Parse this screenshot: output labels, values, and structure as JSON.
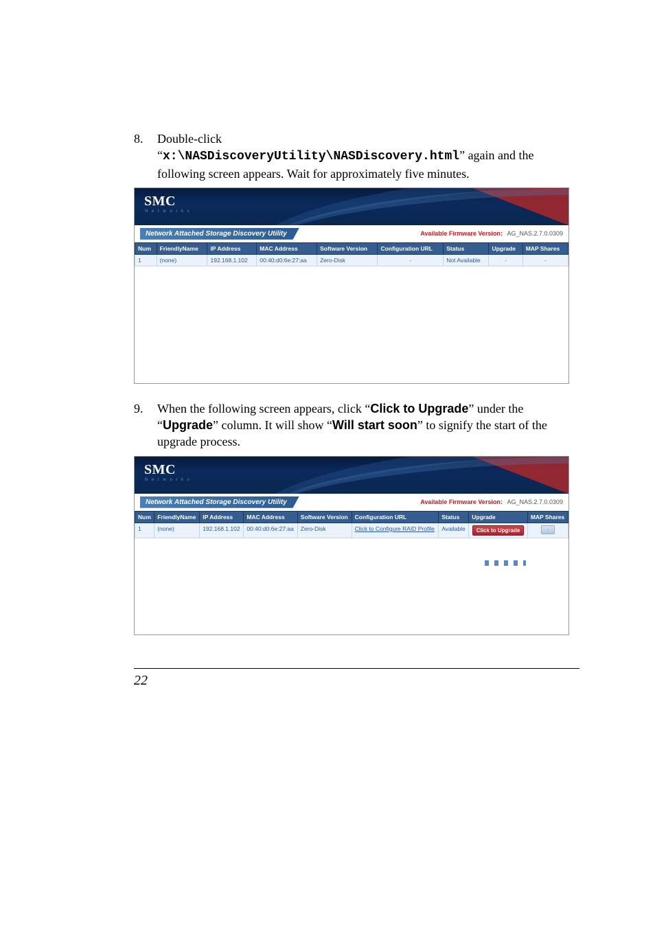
{
  "step8": {
    "num": "8.",
    "title": "Double-click",
    "path_pre": "“",
    "path": "x:\\NASDiscoveryUtility\\NASDiscovery.html",
    "path_post": "” again and the following screen appears. Wait for approximately five minutes."
  },
  "step9": {
    "num": "9.",
    "line1_a": "When the following screen appears, click “",
    "bold1": "Click to Upgrade",
    "line1_b": "” under the “",
    "bold2": "Upgrade",
    "line2_a": "” column. It will show “",
    "bold3": "Will start soon",
    "line2_b": "” to signify the start of the upgrade process."
  },
  "logo": {
    "main": "SMC",
    "sub": "N e t w o r k s"
  },
  "utility_title": "Network Attached Storage Discovery Utility",
  "fw_label": "Available Firmware Version:",
  "fw_value": "AG_NAS.2.7.0.0309",
  "headers1": [
    "Num",
    "FriendlyName",
    "IP Address",
    "MAC Address",
    "Software Version",
    "Configuration URL",
    "Status",
    "Upgrade",
    "MAP Shares"
  ],
  "row1": {
    "num": "1",
    "name": "(none)",
    "ip": "192.168.1.102",
    "mac": "00:40:d0:6e:27:aa",
    "sw": "Zero-Disk",
    "cfg": "-",
    "status": "Not Available",
    "upgrade": "-",
    "map": "-"
  },
  "headers2": [
    "Num",
    "FriendlyName",
    "IP Address",
    "MAC Address",
    "Software Version",
    "Configuration URL",
    "Status",
    "Upgrade",
    "MAP Shares"
  ],
  "row2": {
    "num": "1",
    "name": "(none)",
    "ip": "192.168.1.102",
    "mac": "00:40:d0:6e:27:aa",
    "sw": "Zero-Disk",
    "cfg": "Click to Configure RAID Profile",
    "status": "Available",
    "upgrade": "Click to Upgrade",
    "map": "-"
  },
  "page_number": "22"
}
